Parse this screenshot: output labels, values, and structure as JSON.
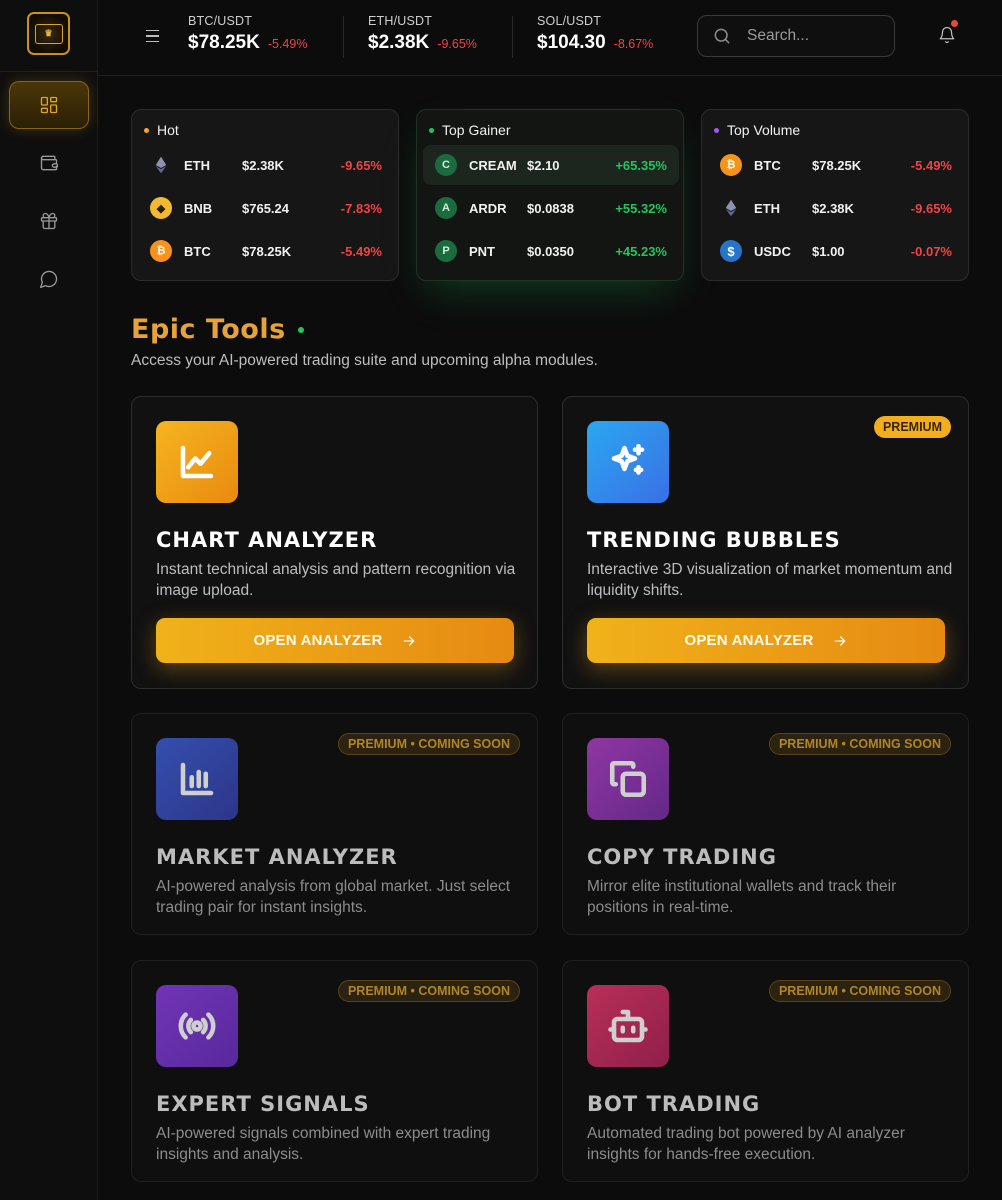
{
  "header": {
    "tickers": [
      {
        "pair": "BTC/USDT",
        "price": "$78.25K",
        "change": "-5.49%"
      },
      {
        "pair": "ETH/USDT",
        "price": "$2.38K",
        "change": "-9.65%"
      },
      {
        "pair": "SOL/USDT",
        "price": "$104.30",
        "change": "-8.67%"
      }
    ],
    "search_placeholder": "Search...",
    "notification_dot": true
  },
  "sidebar": {
    "items": [
      {
        "icon": "dashboard-icon",
        "active": true
      },
      {
        "icon": "wallet-icon",
        "active": false
      },
      {
        "icon": "gift-icon",
        "active": false
      },
      {
        "icon": "chat-icon",
        "active": false
      }
    ]
  },
  "market": {
    "cards": [
      {
        "title": "Hot",
        "dot_color": "#f5a623",
        "rows": [
          {
            "symbol": "ETH",
            "price": "$2.38K",
            "change": "-9.65%"
          },
          {
            "symbol": "BNB",
            "price": "$765.24",
            "change": "-7.83%"
          },
          {
            "symbol": "BTC",
            "price": "$78.25K",
            "change": "-5.49%"
          }
        ]
      },
      {
        "title": "Top Gainer",
        "dot_color": "#22c55e",
        "rows": [
          {
            "symbol": "CREAM",
            "letter": "C",
            "price": "$2.10",
            "change": "+65.35%"
          },
          {
            "symbol": "ARDR",
            "letter": "A",
            "price": "$0.0838",
            "change": "+55.32%"
          },
          {
            "symbol": "PNT",
            "letter": "P",
            "price": "$0.0350",
            "change": "+45.23%"
          }
        ]
      },
      {
        "title": "Top Volume",
        "dot_color": "#a855f7",
        "rows": [
          {
            "symbol": "BTC",
            "price": "$78.25K",
            "change": "-5.49%"
          },
          {
            "symbol": "ETH",
            "price": "$2.38K",
            "change": "-9.65%"
          },
          {
            "symbol": "USDC",
            "price": "$1.00",
            "change": "-0.07%"
          }
        ]
      }
    ]
  },
  "tools_section": {
    "title": "Epic Tools",
    "subtitle": "Access your AI-powered trading suite and upcoming alpha modules."
  },
  "tools": [
    {
      "name": "CHART ANALYZER",
      "description": "Instant technical analysis and pattern recognition via image upload.",
      "button": "OPEN ANALYZER",
      "badge": "",
      "icon": "line-chart-icon"
    },
    {
      "name": "TRENDING BUBBLES",
      "description": "Interactive 3D visualization of market momentum and liquidity shifts.",
      "button": "OPEN ANALYZER",
      "badge": "PREMIUM",
      "icon": "sparkles-icon"
    },
    {
      "name": "MARKET ANALYZER",
      "description": "AI-powered analysis from global market. Just select trading pair for instant insights.",
      "badge": "PREMIUM • COMING SOON",
      "icon": "bar-chart-icon"
    },
    {
      "name": "COPY TRADING",
      "description": "Mirror elite institutional wallets and track their positions in real-time.",
      "badge": "PREMIUM • COMING SOON",
      "icon": "copy-icon"
    },
    {
      "name": "EXPERT SIGNALS",
      "description": "AI-powered signals combined with expert trading insights and analysis.",
      "badge": "PREMIUM • COMING SOON",
      "icon": "radio-signal-icon"
    },
    {
      "name": "BOT TRADING",
      "description": "Automated trading bot powered by AI analyzer insights for hands-free execution.",
      "badge": "PREMIUM • COMING SOON",
      "icon": "robot-icon"
    }
  ]
}
